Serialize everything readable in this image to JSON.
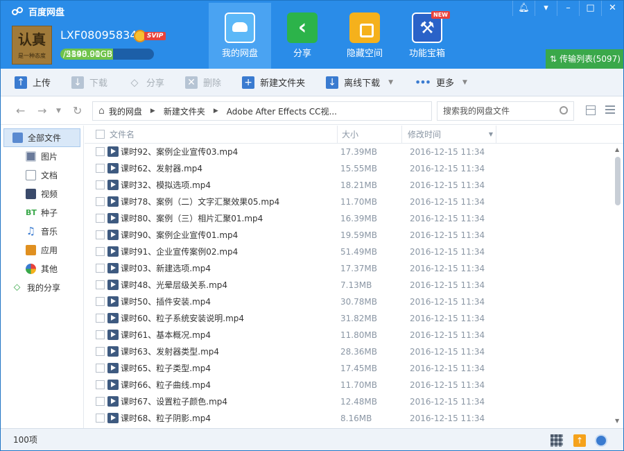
{
  "app": {
    "name": "百度网盘"
  },
  "user": {
    "avatar_text": "认真",
    "avatar_subtext": "是一种态度",
    "name": "LXF08095834",
    "vip_label": "SVIP",
    "quota_used": "2898.91GB",
    "quota_total": "5140.00GB",
    "quota_fraction": 0.564
  },
  "nav_tabs": [
    {
      "label": "我的网盘",
      "icon": "cloud-disk-icon",
      "active": true
    },
    {
      "label": "分享",
      "icon": "share-icon",
      "active": false
    },
    {
      "label": "隐藏空间",
      "icon": "lock-safe-icon",
      "active": false
    },
    {
      "label": "功能宝箱",
      "icon": "toolbox-icon",
      "active": false,
      "badge": "NEW"
    }
  ],
  "window_controls": {
    "notify": "bell-icon",
    "menu": "menu-icon",
    "minimize": "minimize-icon",
    "maximize": "maximize-icon",
    "close": "close-icon"
  },
  "transfer": {
    "label": "传输列表",
    "count": "(5097)"
  },
  "toolbar": {
    "upload": "上传",
    "download": "下载",
    "share": "分享",
    "delete": "删除",
    "new_folder": "新建文件夹",
    "offline_download": "离线下载",
    "more": "更多"
  },
  "breadcrumb": {
    "home": "我的网盘",
    "level1": "新建文件夹",
    "level2": "Adobe After Effects CC视..."
  },
  "search": {
    "placeholder": "搜索我的网盘文件"
  },
  "sidebar": {
    "all_files": "全部文件",
    "items": [
      {
        "label": "图片",
        "icon": "image-icon"
      },
      {
        "label": "文档",
        "icon": "document-icon"
      },
      {
        "label": "视频",
        "icon": "video-icon"
      },
      {
        "label": "种子",
        "icon": "bt-icon"
      },
      {
        "label": "音乐",
        "icon": "music-icon"
      },
      {
        "label": "应用",
        "icon": "app-icon"
      },
      {
        "label": "其他",
        "icon": "other-icon"
      }
    ],
    "my_share": "我的分享"
  },
  "columns": {
    "name": "文件名",
    "size": "大小",
    "time": "修改时间"
  },
  "files": [
    {
      "name": "课时92、案例企业宣传03.mp4",
      "size": "17.39MB",
      "time": "2016-12-15 11:34"
    },
    {
      "name": "课时62、发射器.mp4",
      "size": "15.55MB",
      "time": "2016-12-15 11:34"
    },
    {
      "name": "课时32、模拟选项.mp4",
      "size": "18.21MB",
      "time": "2016-12-15 11:34"
    },
    {
      "name": "课时78、案例（二）文字汇聚效果05.mp4",
      "size": "11.70MB",
      "time": "2016-12-15 11:34"
    },
    {
      "name": "课时80、案例（三）相片汇聚01.mp4",
      "size": "16.39MB",
      "time": "2016-12-15 11:34"
    },
    {
      "name": "课时90、案例企业宣传01.mp4",
      "size": "19.59MB",
      "time": "2016-12-15 11:34"
    },
    {
      "name": "课时91、企业宣传案例02.mp4",
      "size": "51.49MB",
      "time": "2016-12-15 11:34"
    },
    {
      "name": "课时03、新建选项.mp4",
      "size": "17.37MB",
      "time": "2016-12-15 11:34"
    },
    {
      "name": "课时48、光晕层级关系.mp4",
      "size": "7.13MB",
      "time": "2016-12-15 11:34"
    },
    {
      "name": "课时50、插件安装.mp4",
      "size": "30.78MB",
      "time": "2016-12-15 11:34"
    },
    {
      "name": "课时60、粒子系统安装说明.mp4",
      "size": "31.82MB",
      "time": "2016-12-15 11:34"
    },
    {
      "name": "课时61、基本概况.mp4",
      "size": "11.80MB",
      "time": "2016-12-15 11:34"
    },
    {
      "name": "课时63、发射器类型.mp4",
      "size": "28.36MB",
      "time": "2016-12-15 11:34"
    },
    {
      "name": "课时65、粒子类型.mp4",
      "size": "17.45MB",
      "time": "2016-12-15 11:34"
    },
    {
      "name": "课时66、粒子曲线.mp4",
      "size": "11.70MB",
      "time": "2016-12-15 11:34"
    },
    {
      "name": "课时67、设置粒子颜色.mp4",
      "size": "12.48MB",
      "time": "2016-12-15 11:34"
    },
    {
      "name": "课时68、粒子阴影.mp4",
      "size": "8.16MB",
      "time": "2016-12-15 11:34"
    }
  ],
  "status": {
    "count": "100项"
  },
  "colors": {
    "header": "#2a8ce8",
    "transfer": "#3aa84a",
    "accent": "#3a7bd0"
  }
}
